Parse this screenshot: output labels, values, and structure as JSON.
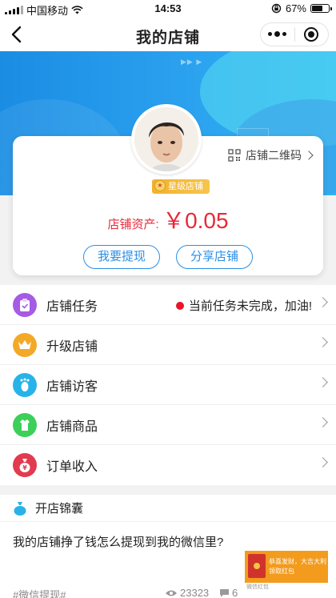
{
  "status_bar": {
    "carrier": "中国移动",
    "time": "14:53",
    "battery_text": "67%",
    "battery_level": 0.67
  },
  "nav": {
    "title": "我的店铺",
    "back_icon": "back-arrow-icon",
    "more_icon": "more-dots-icon",
    "close_icon": "target-circle-icon"
  },
  "store": {
    "qr_label": "店铺二维码",
    "level_badge": "星级店铺",
    "assets_label": "店铺资产:",
    "assets_value": "￥0.05",
    "withdraw_label": "我要提现",
    "share_label": "分享店铺"
  },
  "menu": {
    "items": [
      {
        "label": "店铺任务",
        "icon": "task-clipboard-icon",
        "color": "#a55be6",
        "note": "当前任务未完成，加油!"
      },
      {
        "label": "升级店铺",
        "icon": "crown-icon",
        "color": "#f3a928"
      },
      {
        "label": "店铺访客",
        "icon": "footprint-icon",
        "color": "#27b3ea"
      },
      {
        "label": "店铺商品",
        "icon": "goods-bag-icon",
        "color": "#3ccf5a"
      },
      {
        "label": "订单收入",
        "icon": "money-bag-icon",
        "color": "#e23a4e"
      }
    ]
  },
  "tips": {
    "title": "开店锦囊",
    "article_title": "我的店铺挣了钱怎么提现到我的微信里?",
    "tag": "#微信提现#",
    "views": "23323",
    "comments": "6"
  },
  "ad": {
    "line1": "恭喜发财，大吉大利",
    "line2": "领取红包",
    "footer": "微信红包"
  },
  "colors": {
    "accent_blue": "#2b8fe5",
    "price_red": "#e8283a",
    "banner_start": "#1a8de3",
    "banner_end": "#31b6f3"
  }
}
